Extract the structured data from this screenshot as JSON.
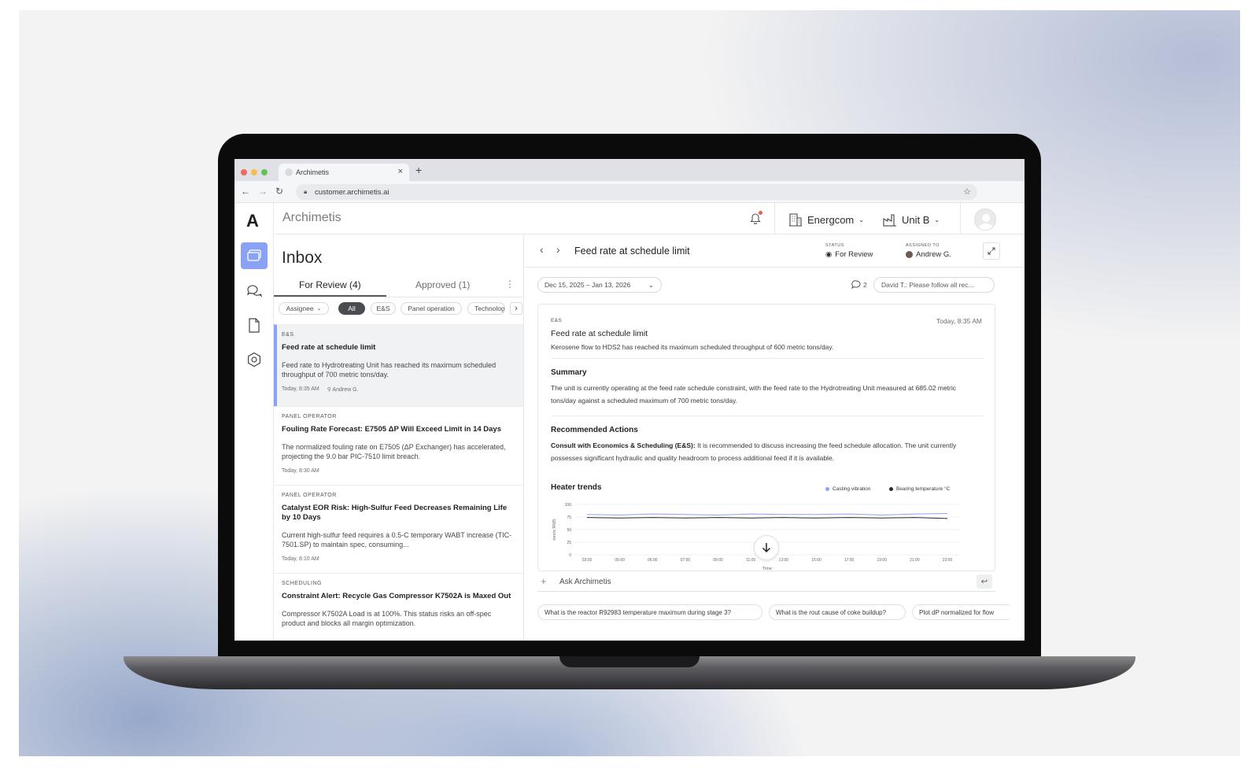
{
  "browser": {
    "tab_title": "Archimetis",
    "url": "customer.archimetis.ai"
  },
  "app": {
    "brand": "Archimetis",
    "logo_glyph": "A",
    "org_selector": "Energcom",
    "unit_selector": "Unit B"
  },
  "inbox": {
    "title": "Inbox",
    "tabs": [
      {
        "label": "For Review (4)",
        "active": true
      },
      {
        "label": "Approved (1)",
        "active": false
      }
    ],
    "filters": {
      "assignee": "Assignee",
      "chips": [
        "All",
        "E&S",
        "Panel operation",
        "Technology"
      ]
    },
    "items": [
      {
        "category": "E&S",
        "title": "Feed rate at schedule limit",
        "description": "Feed rate to Hydrotreating Unit has reached its maximum scheduled throughput of 700 metric tons/day.",
        "time": "Today, 8:35 AM",
        "assignee": "Andrew G."
      },
      {
        "category": "PANEL OPERATOR",
        "title": "Fouling Rate Forecast: E7505 ΔP Will Exceed Limit in 14 Days",
        "description": "The normalized fouling rate on E7505 (ΔP Exchanger) has accelerated, projecting the 9.0 bar PIC-7510 limit breach.",
        "time": "Today, 8:30 AM"
      },
      {
        "category": "PANEL OPERATOR",
        "title": "Catalyst EOR Risk: High-Sulfur Feed Decreases Remaining Life by 10 Days",
        "description": "Current high-sulfur feed requires a 0.5-C temporary WABT increase (TIC-7501.SP) to maintain spec, consuming...",
        "time": "Today, 8:10 AM"
      },
      {
        "category": "SCHEDULING",
        "title": "Constraint Alert: Recycle Gas Compressor K7502A is Maxed Out",
        "description": "Compressor K7502A Load is at 100%. This status risks an off-spec product and blocks all margin optimization."
      }
    ]
  },
  "detail": {
    "title": "Feed rate at schedule limit",
    "status_label": "STATUS",
    "status_value": "For Review",
    "assigned_label": "ASSIGNED TO",
    "assigned_value": "Andrew G.",
    "date_range": "Dec 15, 2025 – Jan 13, 2026",
    "comment_count": "2",
    "comment_preview": "David T.: Please follow all rec...",
    "card": {
      "category": "E&S",
      "time": "Today, 8:35 AM",
      "title": "Feed rate at schedule limit",
      "lead": "Kerosene flow to HDS2 has reached its maximum scheduled throughput of 600 metric tons/day.",
      "summary_heading": "Summary",
      "summary": "The unit is currently operating at the feed rate schedule constraint, with the feed rate to the Hydrotreating Unit measured at 685.02 metric tons/day against a scheduled maximum of 700 metric tons/day.",
      "actions_heading": "Recommended Actions",
      "action_lead": "Consult with Economics & Scheduling (E&S):",
      "action_text": " It is recommended to discuss increasing the feed schedule allocation. The unit currently possesses significant hydraulic and quality headroom to process additional feed if it is available.",
      "chart_heading": "Heater trends"
    },
    "ask_placeholder": "Ask Archimetis",
    "suggestions": [
      "What is the reactor R92983 temperature  maximum during stage 3?",
      "What is the rout cause of coke buildup?",
      "Plot dP normalized for flow"
    ]
  },
  "colors": {
    "accent": "#8aa2f4",
    "series_vibration": "#8aa2f4",
    "series_bearing": "#2b2c30",
    "notification": "#ee5a4d"
  },
  "icons": {
    "rail": [
      "inbox-icon",
      "chat-icon",
      "document-icon",
      "settings-icon"
    ]
  },
  "chart_data": {
    "type": "line",
    "title": "Heater trends",
    "xlabel": "Time",
    "ylabel": "mm/s RMS",
    "ylim": [
      0,
      100
    ],
    "yticks": [
      "100",
      "75",
      "50",
      "25",
      "0"
    ],
    "categories": [
      "03:00",
      "05:00",
      "06:00",
      "07:00",
      "09:00",
      "11:00",
      "13:00",
      "15:00",
      "17:00",
      "19:00",
      "21:00",
      "23:00"
    ],
    "series": [
      {
        "name": "Casting vibration",
        "values": [
          80,
          79,
          81,
          80,
          79,
          81,
          80,
          80,
          81,
          79,
          81,
          82
        ]
      },
      {
        "name": "Bearing temperature °C",
        "values": [
          74,
          73,
          74,
          73,
          74,
          73,
          74,
          73,
          74,
          73,
          74,
          72
        ]
      }
    ],
    "legend": "top-right",
    "grid": true
  }
}
